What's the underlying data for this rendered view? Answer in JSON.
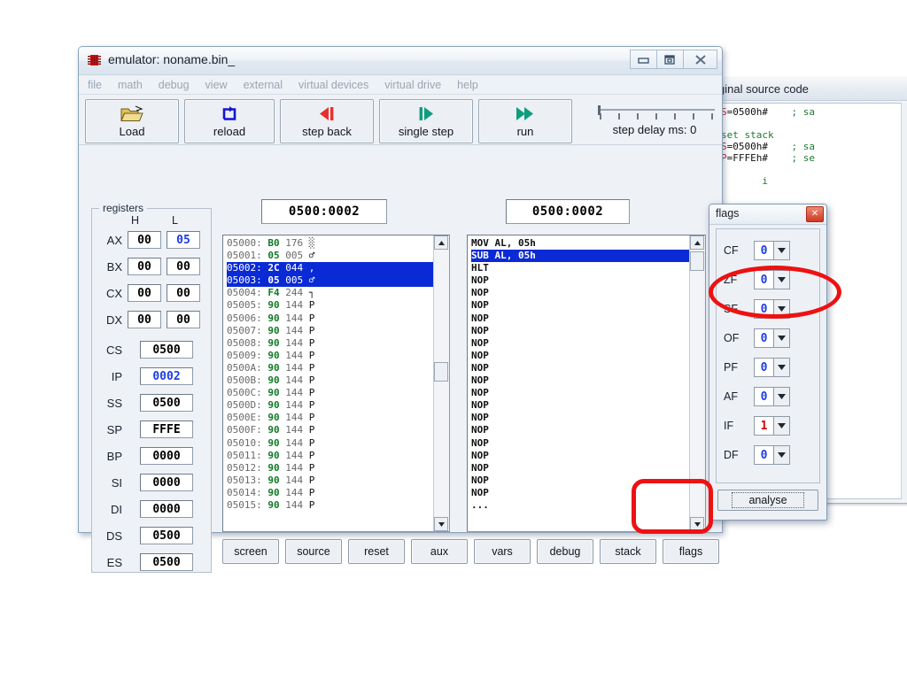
{
  "window": {
    "title": "emulator: noname.bin_",
    "icon": "chip-icon",
    "buttons": {
      "minimize": "minimize-icon",
      "restore": "restore-icon",
      "close": "close-icon"
    }
  },
  "menu": {
    "items": [
      "file",
      "math",
      "debug",
      "view",
      "external",
      "virtual devices",
      "virtual drive",
      "help"
    ]
  },
  "toolbar": {
    "buttons": [
      {
        "id": "load",
        "label": "Load",
        "icon": "open-folder-icon"
      },
      {
        "id": "reload",
        "label": "reload",
        "icon": "refresh-icon"
      },
      {
        "id": "stepback",
        "label": "step back",
        "icon": "step-back-icon"
      },
      {
        "id": "singlestep",
        "label": "single step",
        "icon": "step-forward-icon"
      },
      {
        "id": "run",
        "label": "run",
        "icon": "run-icon"
      }
    ],
    "step_delay_label": "step delay ms: 0",
    "step_delay_value": 0
  },
  "registers": {
    "legend": "registers",
    "col_high": "H",
    "col_low": "L",
    "pairs": [
      {
        "name": "AX",
        "h": "00",
        "l": "05",
        "h_blue": false,
        "l_blue": true
      },
      {
        "name": "BX",
        "h": "00",
        "l": "00",
        "h_blue": false,
        "l_blue": false
      },
      {
        "name": "CX",
        "h": "00",
        "l": "00",
        "h_blue": false,
        "l_blue": false
      },
      {
        "name": "DX",
        "h": "00",
        "l": "00",
        "h_blue": false,
        "l_blue": false
      }
    ],
    "singles": [
      {
        "name": "CS",
        "value": "0500",
        "blue": false
      },
      {
        "name": "IP",
        "value": "0002",
        "blue": true
      },
      {
        "name": "SS",
        "value": "0500",
        "blue": false
      },
      {
        "name": "SP",
        "value": "FFFE",
        "blue": false
      },
      {
        "name": "BP",
        "value": "0000",
        "blue": false
      },
      {
        "name": "SI",
        "value": "0000",
        "blue": false
      },
      {
        "name": "DI",
        "value": "0000",
        "blue": false
      },
      {
        "name": "DS",
        "value": "0500",
        "blue": false
      },
      {
        "name": "ES",
        "value": "0500",
        "blue": false
      }
    ]
  },
  "memory_panel": {
    "address": "0500:0002",
    "rows": [
      {
        "addr": "05000:",
        "hex": "B0",
        "dec": "176",
        "chr": "░",
        "selected": false
      },
      {
        "addr": "05001:",
        "hex": "05",
        "dec": "005",
        "chr": "♂",
        "selected": false
      },
      {
        "addr": "05002:",
        "hex": "2C",
        "dec": "044",
        "chr": ",",
        "selected": true
      },
      {
        "addr": "05003:",
        "hex": "05",
        "dec": "005",
        "chr": "♂",
        "selected": true
      },
      {
        "addr": "05004:",
        "hex": "F4",
        "dec": "244",
        "chr": "┐",
        "selected": false
      },
      {
        "addr": "05005:",
        "hex": "90",
        "dec": "144",
        "chr": "P",
        "selected": false
      },
      {
        "addr": "05006:",
        "hex": "90",
        "dec": "144",
        "chr": "P",
        "selected": false
      },
      {
        "addr": "05007:",
        "hex": "90",
        "dec": "144",
        "chr": "P",
        "selected": false
      },
      {
        "addr": "05008:",
        "hex": "90",
        "dec": "144",
        "chr": "P",
        "selected": false
      },
      {
        "addr": "05009:",
        "hex": "90",
        "dec": "144",
        "chr": "P",
        "selected": false
      },
      {
        "addr": "0500A:",
        "hex": "90",
        "dec": "144",
        "chr": "P",
        "selected": false
      },
      {
        "addr": "0500B:",
        "hex": "90",
        "dec": "144",
        "chr": "P",
        "selected": false
      },
      {
        "addr": "0500C:",
        "hex": "90",
        "dec": "144",
        "chr": "P",
        "selected": false
      },
      {
        "addr": "0500D:",
        "hex": "90",
        "dec": "144",
        "chr": "P",
        "selected": false
      },
      {
        "addr": "0500E:",
        "hex": "90",
        "dec": "144",
        "chr": "P",
        "selected": false
      },
      {
        "addr": "0500F:",
        "hex": "90",
        "dec": "144",
        "chr": "P",
        "selected": false
      },
      {
        "addr": "05010:",
        "hex": "90",
        "dec": "144",
        "chr": "P",
        "selected": false
      },
      {
        "addr": "05011:",
        "hex": "90",
        "dec": "144",
        "chr": "P",
        "selected": false
      },
      {
        "addr": "05012:",
        "hex": "90",
        "dec": "144",
        "chr": "P",
        "selected": false
      },
      {
        "addr": "05013:",
        "hex": "90",
        "dec": "144",
        "chr": "P",
        "selected": false
      },
      {
        "addr": "05014:",
        "hex": "90",
        "dec": "144",
        "chr": "P",
        "selected": false
      },
      {
        "addr": "05015:",
        "hex": "90",
        "dec": "144",
        "chr": "P",
        "selected": false
      }
    ]
  },
  "disassembly_panel": {
    "address": "0500:0002",
    "rows": [
      {
        "text": "MOV AL, 05h",
        "selected": false
      },
      {
        "text": "SUB AL, 05h",
        "selected": true
      },
      {
        "text": "HLT",
        "selected": false
      },
      {
        "text": "NOP",
        "selected": false
      },
      {
        "text": "NOP",
        "selected": false
      },
      {
        "text": "NOP",
        "selected": false
      },
      {
        "text": "NOP",
        "selected": false
      },
      {
        "text": "NOP",
        "selected": false
      },
      {
        "text": "NOP",
        "selected": false
      },
      {
        "text": "NOP",
        "selected": false
      },
      {
        "text": "NOP",
        "selected": false
      },
      {
        "text": "NOP",
        "selected": false
      },
      {
        "text": "NOP",
        "selected": false
      },
      {
        "text": "NOP",
        "selected": false
      },
      {
        "text": "NOP",
        "selected": false
      },
      {
        "text": "NOP",
        "selected": false
      },
      {
        "text": "NOP",
        "selected": false
      },
      {
        "text": "NOP",
        "selected": false
      },
      {
        "text": "NOP",
        "selected": false
      },
      {
        "text": "NOP",
        "selected": false
      },
      {
        "text": "NOP",
        "selected": false
      },
      {
        "text": "...",
        "selected": false
      }
    ]
  },
  "bottom_buttons": [
    {
      "id": "screen",
      "label": "screen"
    },
    {
      "id": "source",
      "label": "source"
    },
    {
      "id": "reset",
      "label": "reset"
    },
    {
      "id": "aux",
      "label": "aux"
    },
    {
      "id": "vars",
      "label": "vars"
    },
    {
      "id": "debug",
      "label": "debug"
    },
    {
      "id": "stack",
      "label": "stack"
    },
    {
      "id": "flags",
      "label": "flags"
    }
  ],
  "flags_dialog": {
    "title": "flags",
    "close_label": "✕",
    "analyse_label": "analyse",
    "flags": [
      {
        "name": "CF",
        "value": "0",
        "color": "blue"
      },
      {
        "name": "ZF",
        "value": "0",
        "color": "blue"
      },
      {
        "name": "SF",
        "value": "0",
        "color": "blue"
      },
      {
        "name": "OF",
        "value": "0",
        "color": "blue"
      },
      {
        "name": "PF",
        "value": "0",
        "color": "blue"
      },
      {
        "name": "AF",
        "value": "0",
        "color": "blue"
      },
      {
        "name": "IF",
        "value": "1",
        "color": "red"
      },
      {
        "name": "DF",
        "value": "0",
        "color": "blue"
      }
    ]
  },
  "source_window": {
    "title": "ginal source code",
    "lines": [
      {
        "parts": [
          {
            "t": "S",
            "c": "red"
          },
          {
            "t": "=0500h#",
            "c": "blk"
          },
          {
            "t": "    ; sa",
            "c": "grn"
          }
        ]
      },
      {
        "parts": [
          {
            "t": "",
            "c": "blk"
          }
        ]
      },
      {
        "parts": [
          {
            "t": "set stack",
            "c": "grn"
          }
        ]
      },
      {
        "parts": [
          {
            "t": "S",
            "c": "red"
          },
          {
            "t": "=0500h#",
            "c": "blk"
          },
          {
            "t": "    ; sa",
            "c": "grn"
          }
        ]
      },
      {
        "parts": [
          {
            "t": "P",
            "c": "red"
          },
          {
            "t": "=FFFEh#",
            "c": "blk"
          },
          {
            "t": "    ; se",
            "c": "grn"
          }
        ]
      },
      {
        "parts": [
          {
            "t": "",
            "c": "blk"
          }
        ]
      },
      {
        "parts": [
          {
            "t": "       i",
            "c": "grn"
          }
        ]
      }
    ]
  },
  "colors": {
    "selection": "#0a2ad6",
    "changed_value": "#1b3de8",
    "flag_set": "#d40000",
    "annotation": "#ee1111",
    "hex_green": "#0f7a25"
  }
}
